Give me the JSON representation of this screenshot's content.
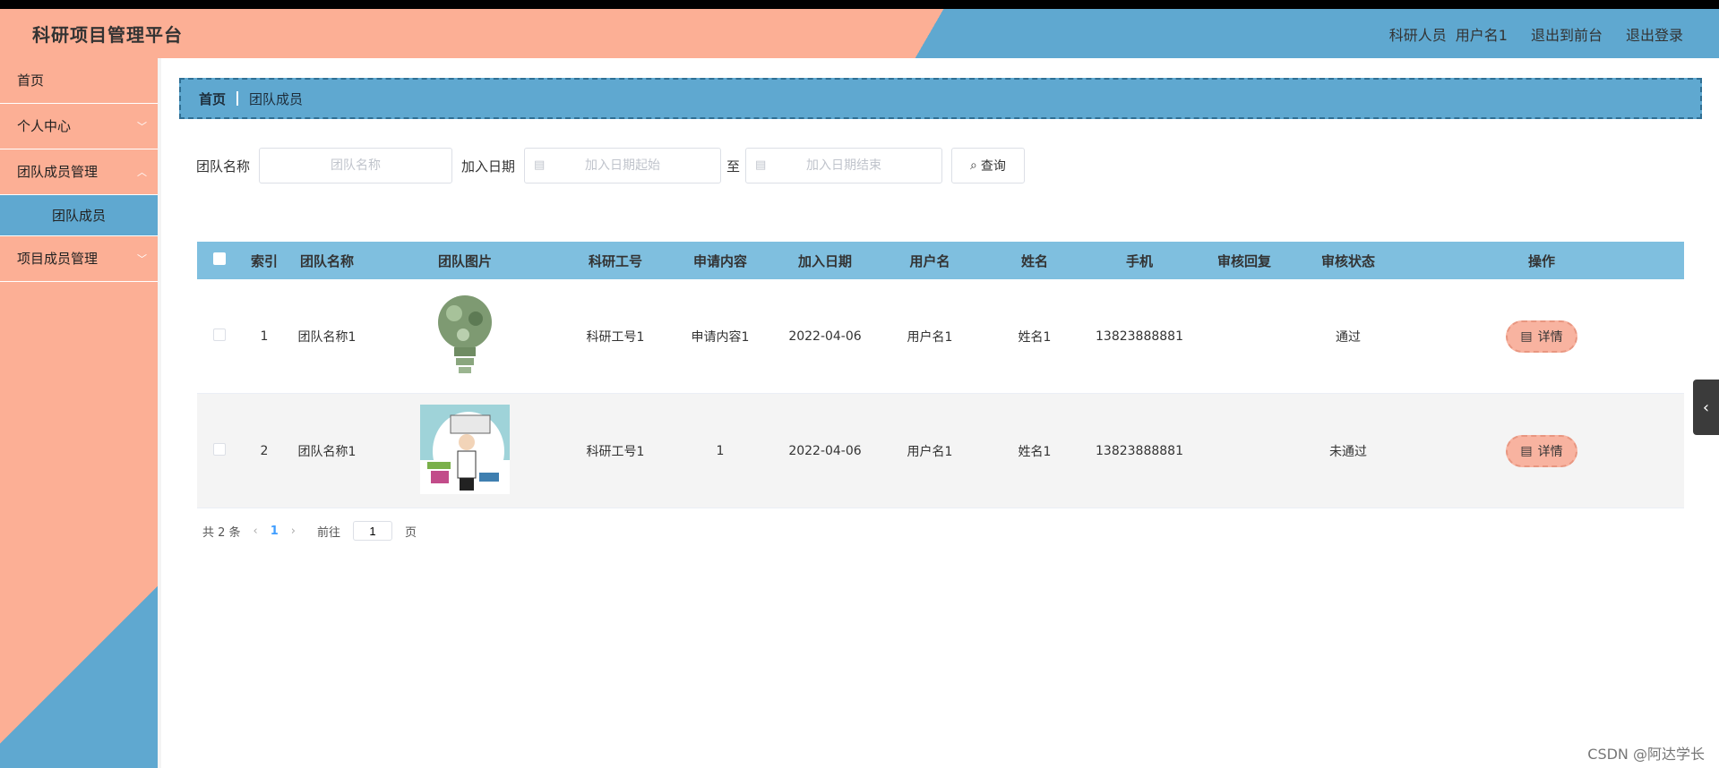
{
  "header": {
    "title": "科研项目管理平台",
    "role": "科研人员",
    "username": "用户名1",
    "front_link": "退出到前台",
    "logout_link": "退出登录"
  },
  "sidebar": {
    "items": [
      {
        "label": "首页"
      },
      {
        "label": "个人中心"
      },
      {
        "label": "团队成员管理"
      },
      {
        "label": "团队成员"
      },
      {
        "label": "项目成员管理"
      }
    ]
  },
  "breadcrumb": {
    "home": "首页",
    "current": "团队成员"
  },
  "search": {
    "team_name_label": "团队名称",
    "team_name_placeholder": "团队名称",
    "join_date_label": "加入日期",
    "date_start_placeholder": "加入日期起始",
    "to_label": "至",
    "date_end_placeholder": "加入日期结束",
    "query_button": "查询"
  },
  "table": {
    "columns": [
      "索引",
      "团队名称",
      "团队图片",
      "科研工号",
      "申请内容",
      "加入日期",
      "用户名",
      "姓名",
      "手机",
      "审核回复",
      "审核状态",
      "操作"
    ],
    "rows": [
      {
        "index": "1",
        "team_name": "团队名称1",
        "work_no": "科研工号1",
        "request": "申请内容1",
        "date": "2022-04-06",
        "username": "用户名1",
        "name": "姓名1",
        "phone": "13823888881",
        "reply": "",
        "status": "通过",
        "action": "详情"
      },
      {
        "index": "2",
        "team_name": "团队名称1",
        "work_no": "科研工号1",
        "request": "1",
        "date": "2022-04-06",
        "username": "用户名1",
        "name": "姓名1",
        "phone": "13823888881",
        "reply": "",
        "status": "未通过",
        "action": "详情"
      }
    ]
  },
  "pagination": {
    "total_text": "共 2 条",
    "current_page": "1",
    "goto_label": "前往",
    "goto_value": "1",
    "page_unit": "页"
  },
  "watermark": "CSDN @阿达学长",
  "colors": {
    "accent_salmon": "#fcaf95",
    "accent_blue": "#5fa8d0",
    "table_header": "#7fbfdf"
  },
  "icons": [
    "search-icon",
    "calendar-icon",
    "chevron-down-icon",
    "document-icon",
    "chevron-left-icon"
  ]
}
